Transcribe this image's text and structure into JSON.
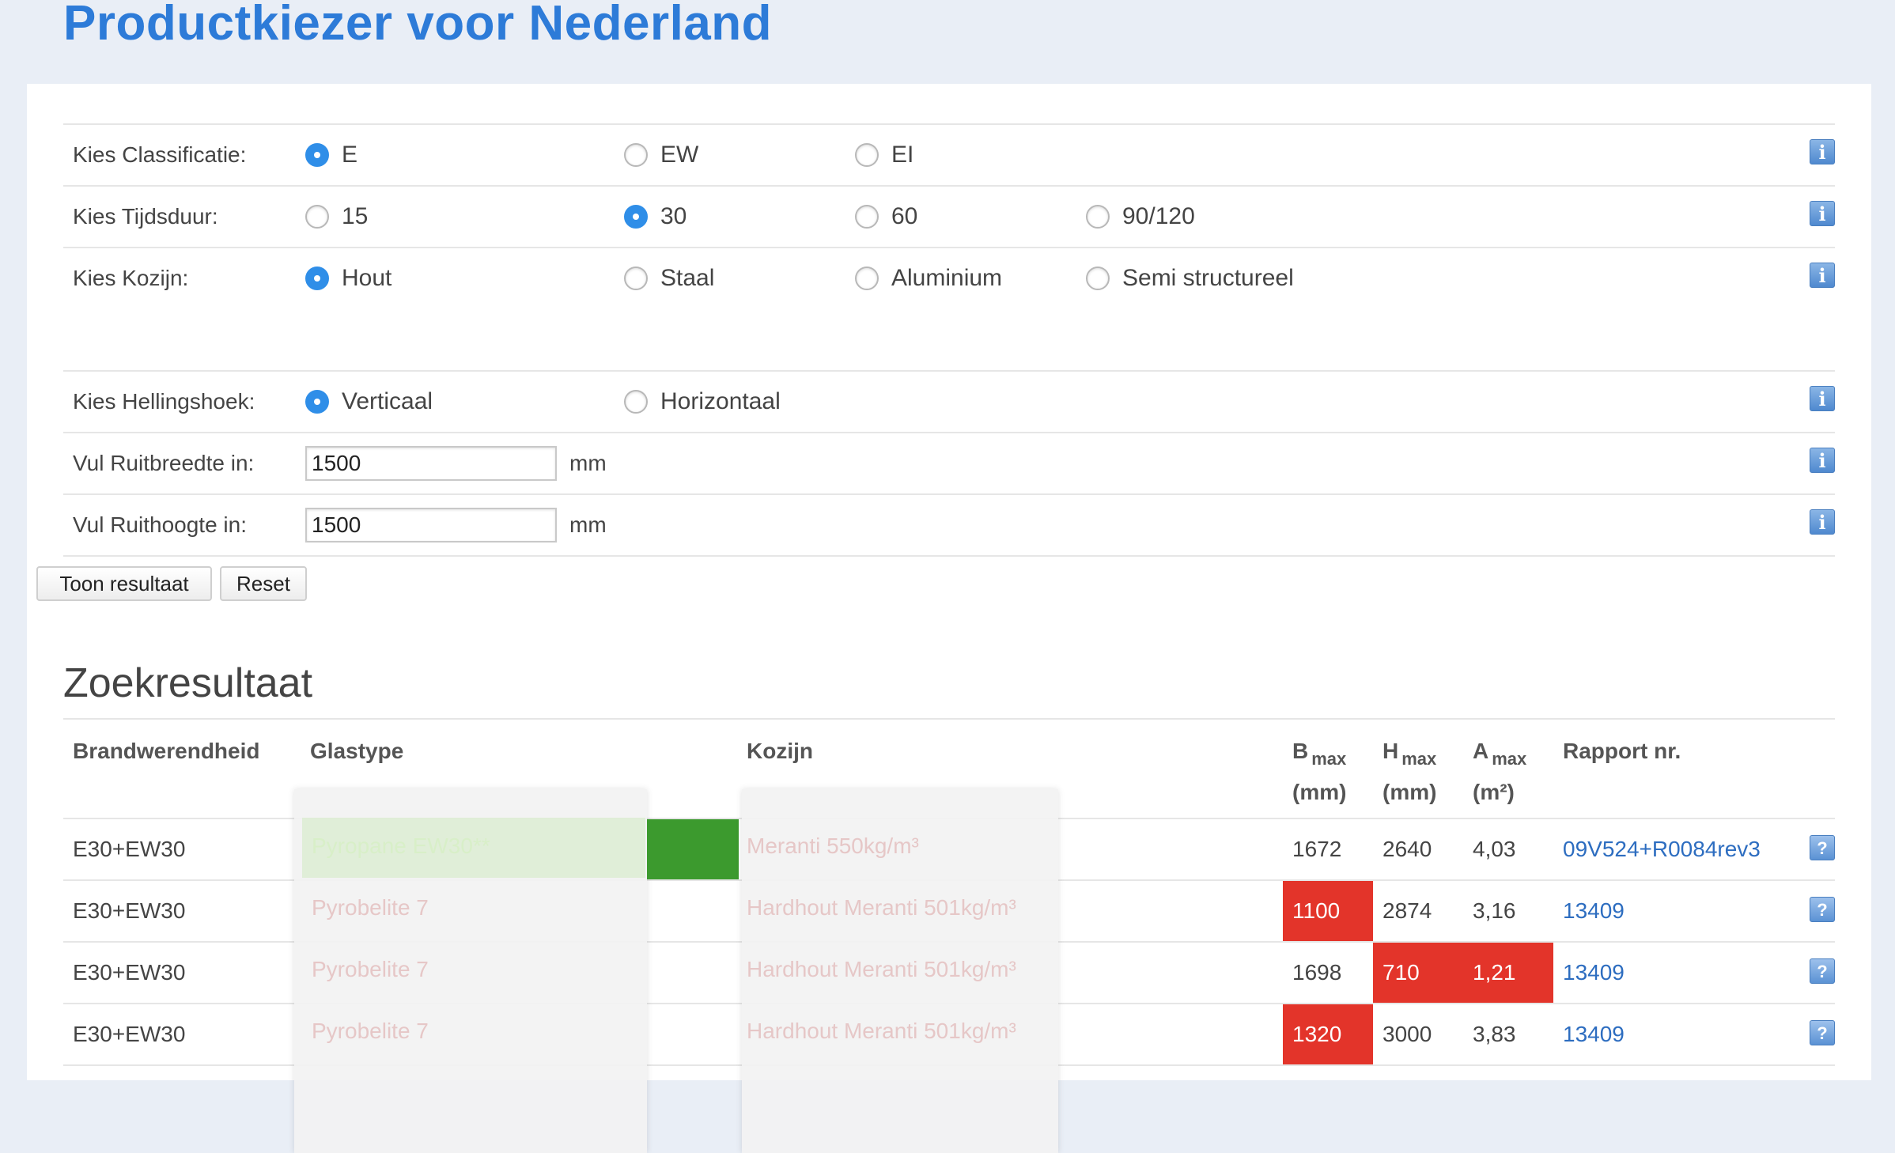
{
  "page": {
    "title": "Productkiezer voor Nederland"
  },
  "form": {
    "classificatie": {
      "label": "Kies Classificatie:",
      "options": [
        "E",
        "EW",
        "EI"
      ],
      "selected": "E"
    },
    "tijdsduur": {
      "label": "Kies Tijdsduur:",
      "options": [
        "15",
        "30",
        "60",
        "90/120"
      ],
      "selected": "30"
    },
    "kozijn": {
      "label": "Kies Kozijn:",
      "options": [
        "Hout",
        "Staal",
        "Aluminium",
        "Semi structureel"
      ],
      "selected": "Hout"
    },
    "hellingshoek": {
      "label": "Kies Hellingshoek:",
      "options": [
        "Verticaal",
        "Horizontaal"
      ],
      "selected": "Verticaal"
    },
    "ruitbreedte": {
      "label": "Vul Ruitbreedte in:",
      "value": "1500",
      "unit": "mm"
    },
    "ruithoogte": {
      "label": "Vul Ruithoogte in:",
      "value": "1500",
      "unit": "mm"
    },
    "info_icon": "i",
    "show_button": "Toon resultaat",
    "reset_button": "Reset"
  },
  "results": {
    "title": "Zoekresultaat",
    "headers": {
      "brandwerendheid": "Brandwerendheid",
      "glastype": "Glastype",
      "kozijn": "Kozijn",
      "b": "B",
      "h": "H",
      "a": "A",
      "max": "max",
      "b_unit": "(mm)",
      "h_unit": "(mm)",
      "a_unit": "(m²)",
      "rapport": "Rapport nr."
    },
    "help_icon": "?",
    "rows": [
      {
        "brandwerendheid": "E30+EW30",
        "glastype": "Pyropane EW30**",
        "kozijn": "Meranti 550kg/m³",
        "b": "1672",
        "h": "2640",
        "a": "4,03",
        "rapport": "09V524+R0084rev3"
      },
      {
        "brandwerendheid": "E30+EW30",
        "glastype": "Pyrobelite 7",
        "kozijn": "Hardhout Meranti 501kg/m³",
        "b": "1100",
        "h": "2874",
        "a": "3,16",
        "rapport": "13409"
      },
      {
        "brandwerendheid": "E30+EW30",
        "glastype": "Pyrobelite 7",
        "kozijn": "Hardhout Meranti 501kg/m³",
        "b": "1698",
        "h": "710",
        "a": "1,21",
        "rapport": "13409"
      },
      {
        "brandwerendheid": "E30+EW30",
        "glastype": "Pyrobelite 7",
        "kozijn": "Hardhout Meranti 501kg/m³",
        "b": "1320",
        "h": "3000",
        "a": "3,83",
        "rapport": "13409"
      }
    ]
  },
  "colors": {
    "title": "#2d7bd8",
    "accent": "#2f8ee8",
    "exceeded": "#e3342a",
    "match": "#3c9a2e",
    "link": "#2d6dc0"
  }
}
